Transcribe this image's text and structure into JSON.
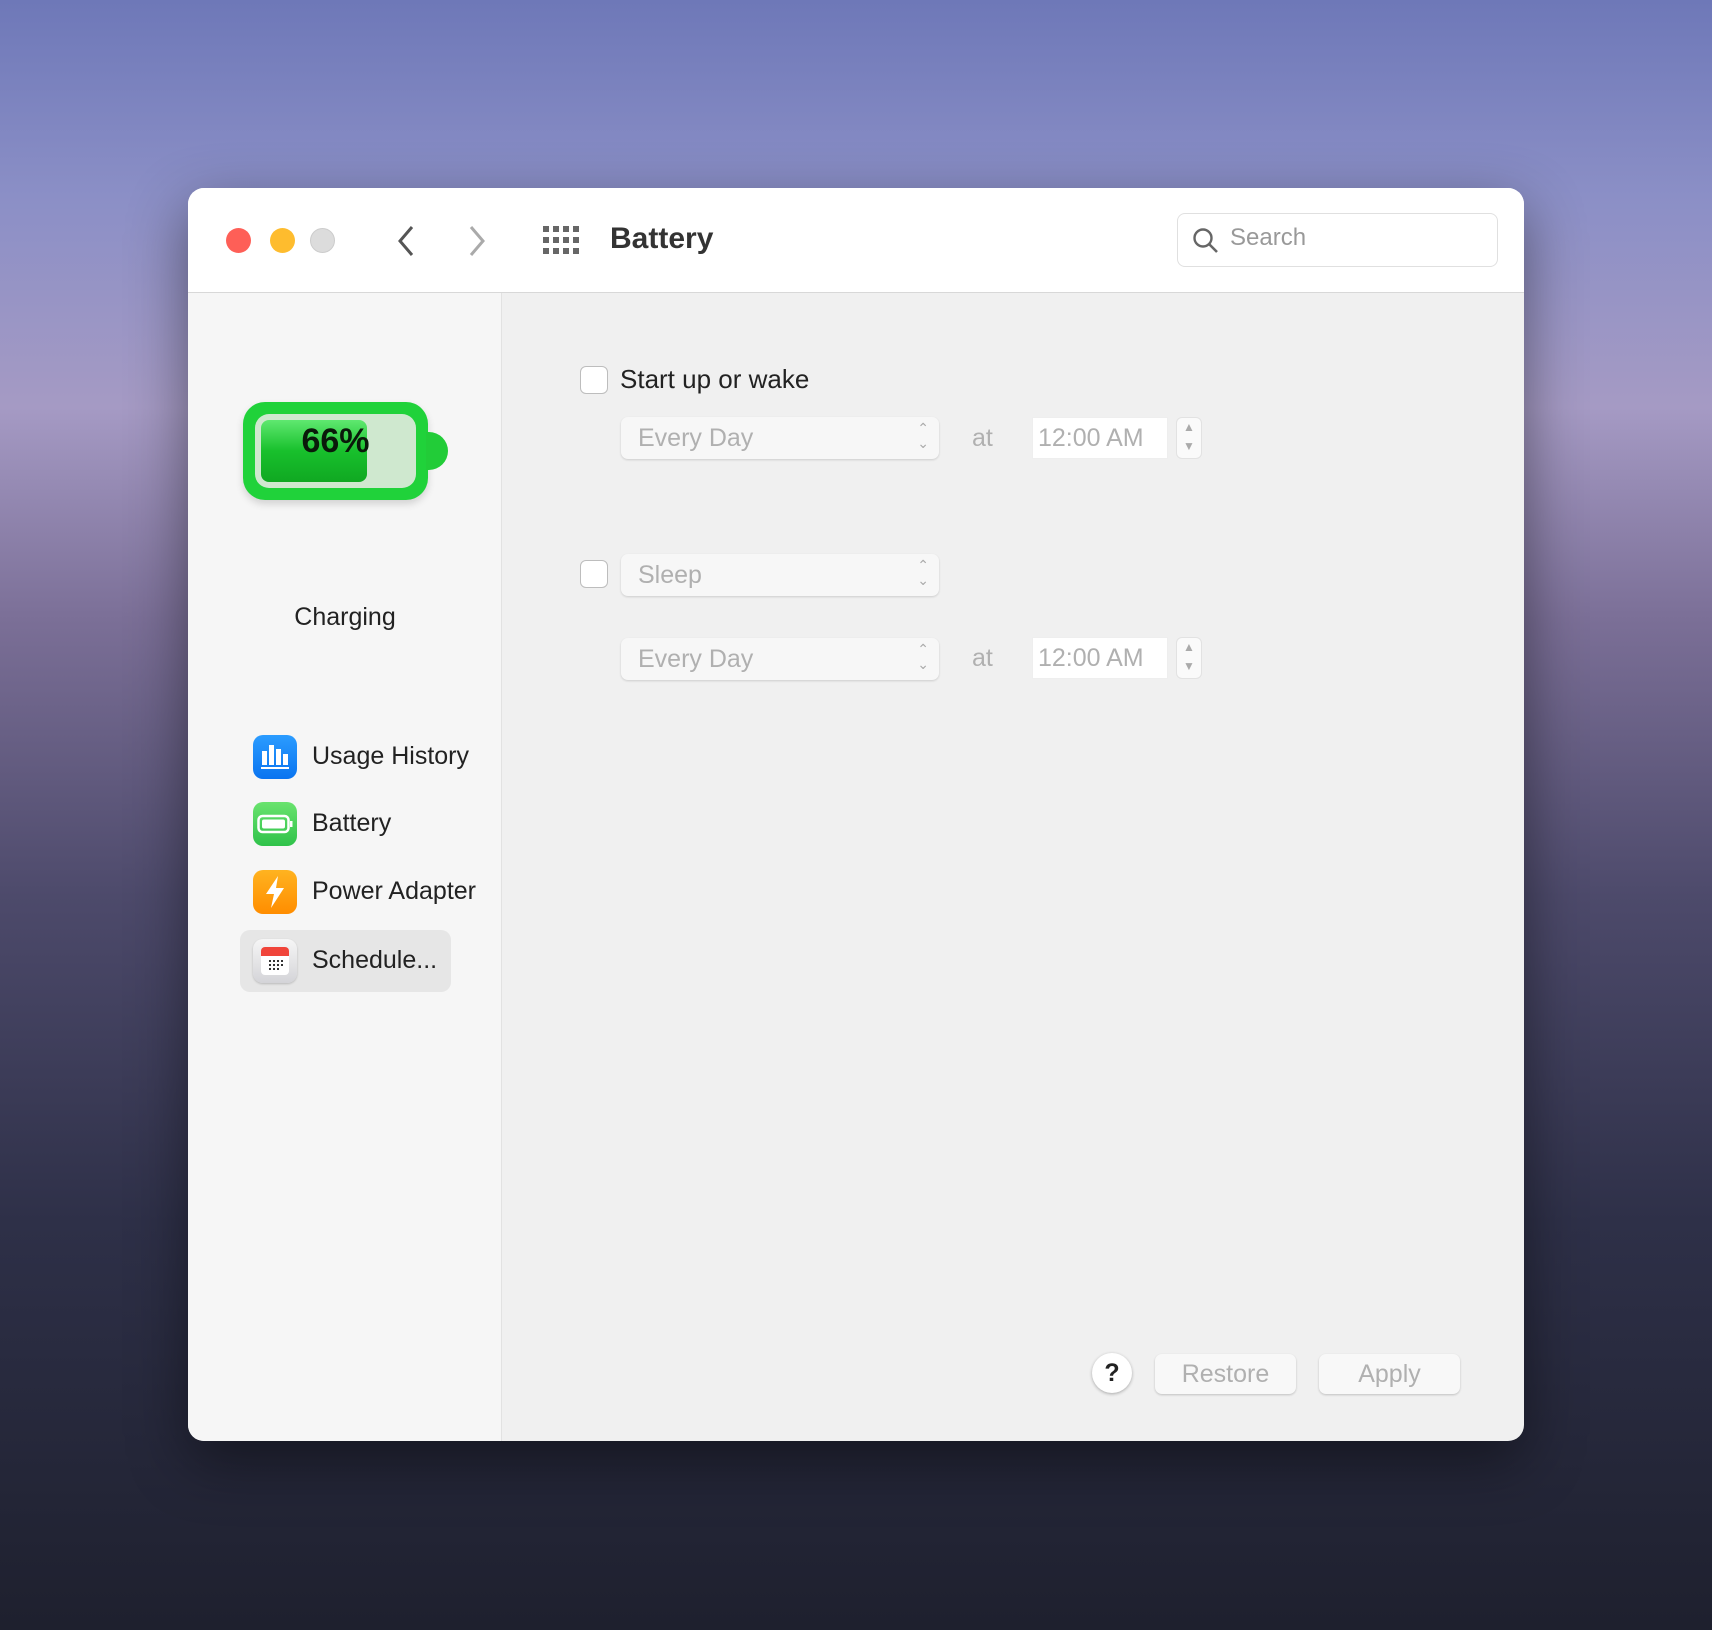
{
  "window": {
    "title": "Battery"
  },
  "search": {
    "placeholder": "Search"
  },
  "sidebar": {
    "battery_level": "66%",
    "battery_level_percent": 66,
    "status": "Charging",
    "items": [
      {
        "label": "Usage History",
        "icon": "bar-chart-icon",
        "color": "#1a8cff"
      },
      {
        "label": "Battery",
        "icon": "battery-icon",
        "color": "#34c759"
      },
      {
        "label": "Power Adapter",
        "icon": "bolt-icon",
        "color": "#ff9f0a"
      },
      {
        "label": "Schedule...",
        "icon": "calendar-icon",
        "selected": true
      }
    ]
  },
  "schedule": {
    "startup": {
      "label": "Start up or wake",
      "checked": false,
      "repeat": "Every Day",
      "at": "at",
      "time": "12:00 AM"
    },
    "sleep": {
      "action": "Sleep",
      "checked": false,
      "repeat": "Every Day",
      "at": "at",
      "time": "12:00 AM"
    }
  },
  "buttons": {
    "help": "?",
    "restore": "Restore",
    "apply": "Apply"
  }
}
